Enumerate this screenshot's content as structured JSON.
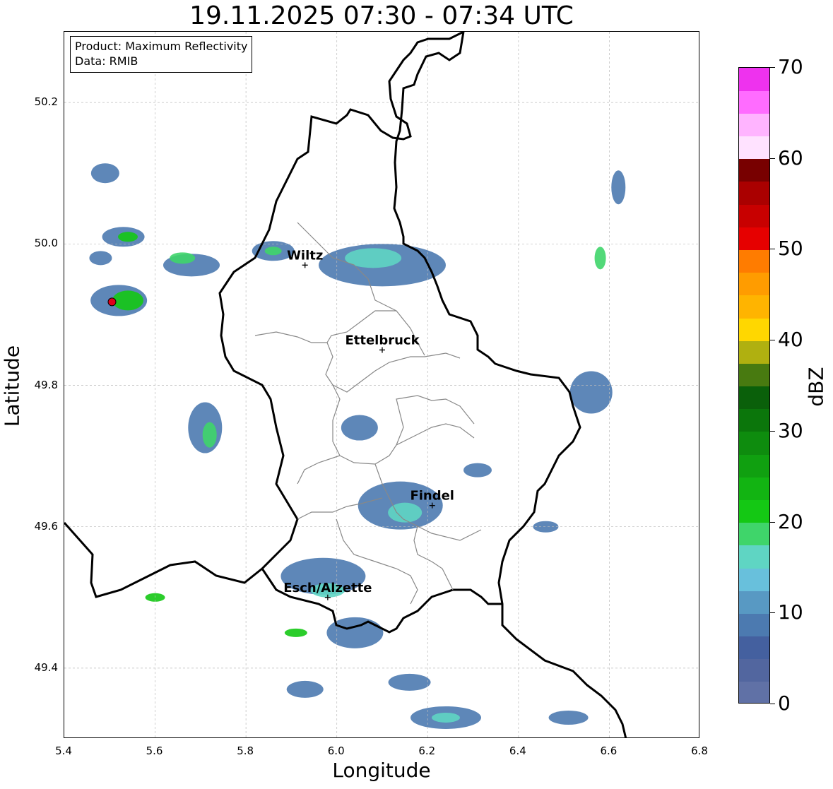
{
  "title": "19.11.2025 07:30 - 07:34 UTC",
  "info": {
    "line1": "Product: Maximum Reflectivity",
    "line2": "Data: RMIB"
  },
  "xlabel": "Longitude",
  "ylabel": "Latitude",
  "xlim": [
    5.4,
    6.8
  ],
  "ylim": [
    49.3,
    50.3
  ],
  "xticks": [
    "5.4",
    "5.6",
    "5.8",
    "6.0",
    "6.2",
    "6.4",
    "6.6",
    "6.8"
  ],
  "yticks": [
    "49.4",
    "49.6",
    "49.8",
    "50.0",
    "50.2"
  ],
  "cities": [
    {
      "name": "Wiltz",
      "lon": 5.93,
      "lat": 49.97
    },
    {
      "name": "Ettelbruck",
      "lon": 6.1,
      "lat": 49.85
    },
    {
      "name": "Findel",
      "lon": 6.21,
      "lat": 49.63
    },
    {
      "name": "Esch/Alzette",
      "lon": 5.98,
      "lat": 49.5
    }
  ],
  "radar_marker": {
    "lon": 5.505,
    "lat": 49.918,
    "color": "#e0001a"
  },
  "colorbar": {
    "label": "dBZ",
    "range": [
      0,
      70
    ],
    "ticks": [
      "0",
      "10",
      "20",
      "30",
      "40",
      "50",
      "60",
      "70"
    ],
    "colors": [
      "#6071a6",
      "#52669f",
      "#44609f",
      "#4c7ab0",
      "#5899c3",
      "#68c0dc",
      "#5fd5c3",
      "#3fd56a",
      "#14c814",
      "#12b412",
      "#10a010",
      "#0e8c0e",
      "#0b760b",
      "#0a600a",
      "#487a10",
      "#b0b010",
      "#ffd700",
      "#ffb400",
      "#ff9c00",
      "#ff7c00",
      "#e60000",
      "#c80000",
      "#aa0000",
      "#780000",
      "#ffe2ff",
      "#ffb4ff",
      "#ff6cff",
      "#ee32ee"
    ]
  }
}
